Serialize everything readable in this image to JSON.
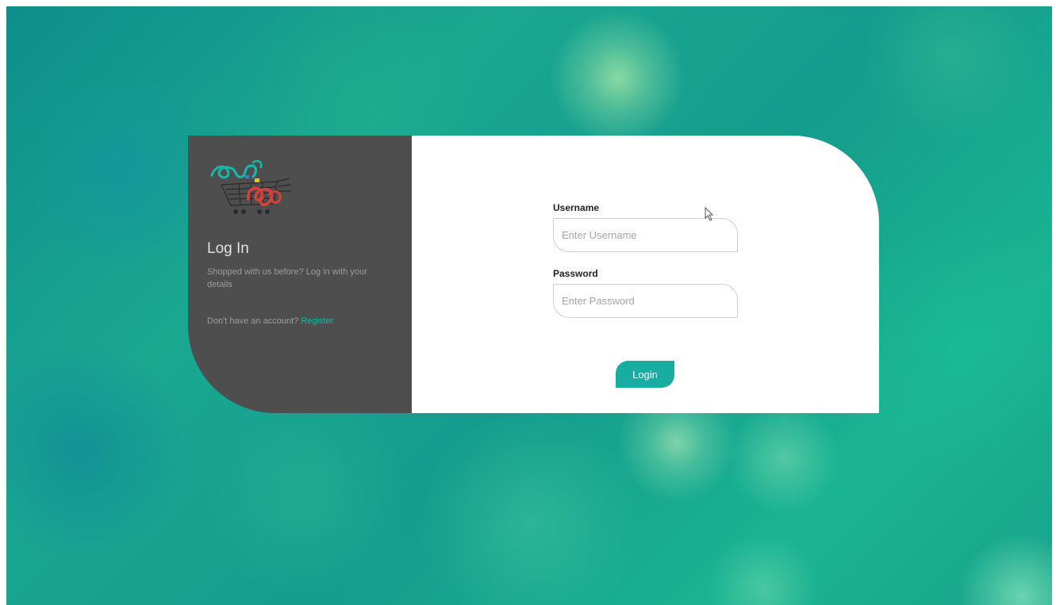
{
  "left_panel": {
    "title": "Log In",
    "subtitle": "Shopped with us before? Log in with your details",
    "no_account_text": "Don't have an account?",
    "register_link": "Register"
  },
  "form": {
    "username_label": "Username",
    "username_placeholder": "Enter Username",
    "password_label": "Password",
    "password_placeholder": "Enter Password",
    "login_label": "Login"
  },
  "colors": {
    "accent": "#17ada0",
    "left_panel_bg": "#4e4e4e",
    "background_primary": "#1aa891"
  },
  "icons": {
    "logo": "shopping-cart-logo-icon",
    "pointer": "mouse-cursor-icon"
  }
}
